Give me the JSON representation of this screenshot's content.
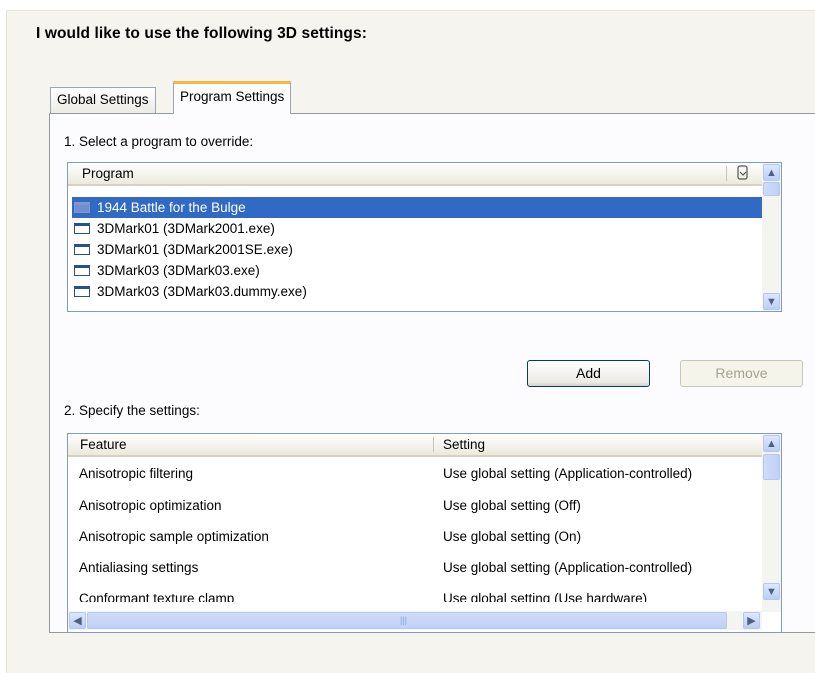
{
  "heading": "I would like to use the following 3D settings:",
  "tabs": [
    {
      "label": "Global Settings",
      "selected": false
    },
    {
      "label": "Program Settings",
      "selected": true
    }
  ],
  "program_section": {
    "label": "1. Select a program to override:",
    "column_header": "Program",
    "header_icon": "program-select-icon",
    "items": [
      {
        "label": "1944 Battle for the Bulge",
        "selected": true
      },
      {
        "label": "3DMark01 (3DMark2001.exe)",
        "selected": false
      },
      {
        "label": "3DMark01 (3DMark2001SE.exe)",
        "selected": false
      },
      {
        "label": "3DMark03 (3DMark03.exe)",
        "selected": false
      },
      {
        "label": "3DMark03 (3DMark03.dummy.exe)",
        "selected": false
      }
    ]
  },
  "buttons": {
    "add": "Add",
    "remove": "Remove"
  },
  "settings_section": {
    "label": "2. Specify the settings:",
    "columns": [
      "Feature",
      "Setting"
    ],
    "rows": [
      {
        "feature": "Anisotropic filtering",
        "setting": "Use global setting (Application-controlled)"
      },
      {
        "feature": "Anisotropic optimization",
        "setting": "Use global setting (Off)"
      },
      {
        "feature": "Anisotropic sample optimization",
        "setting": "Use global setting (On)"
      },
      {
        "feature": "Antialiasing settings",
        "setting": "Use global setting (Application-controlled)"
      },
      {
        "feature": "Conformant texture clamp",
        "setting": "Use global setting (Use hardware)"
      }
    ]
  },
  "colors": {
    "selection": "#316ac5",
    "tab_highlight": "#f5b840",
    "list_border": "#7f9db9"
  }
}
